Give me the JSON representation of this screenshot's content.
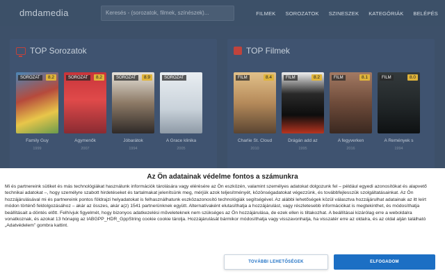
{
  "navbar": {
    "brand": "dmdamedia",
    "search_placeholder": "Keresés - (sorozatok, filmek, színészek)...",
    "items": [
      {
        "label": "FILMEK"
      },
      {
        "label": "SOROZATOK"
      },
      {
        "label": "SZINESZEK"
      },
      {
        "label": "KATEGÓRIÁK"
      },
      {
        "label": "BELÉPÉS"
      }
    ]
  },
  "sections": {
    "series": {
      "title": "TOP Sorozatok",
      "cards": [
        {
          "tag": "SOROZAT",
          "rating": "8.2",
          "title": "Family Guy",
          "year": "1999"
        },
        {
          "tag": "SOROZAT",
          "rating": "8.2",
          "title": "Agymenők",
          "year": "2007"
        },
        {
          "tag": "SOROZAT",
          "rating": "8.9",
          "title": "Jóbarátok",
          "year": "1994"
        },
        {
          "tag": "SOROZAT",
          "rating": "",
          "title": "A Grace klinika",
          "year": "2005"
        }
      ]
    },
    "films": {
      "title": "TOP Filmek",
      "cards": [
        {
          "tag": "FILM",
          "rating": "8.4",
          "title": "Charlie St. Cloud",
          "year": "2010"
        },
        {
          "tag": "FILM",
          "rating": "8.2",
          "title": "Drágán add az",
          "year": "1995"
        },
        {
          "tag": "FILM",
          "rating": "8.1",
          "title": "A fegyverken",
          "year": "2016"
        },
        {
          "tag": "FILM",
          "rating": "8.0",
          "title": "A Remények s",
          "year": "1994"
        }
      ]
    }
  },
  "consent": {
    "title": "Az Ön adatainak védelme fontos a számunkra",
    "body": "Mi és partnereink sütiket és más technológiákat használunk információk tárolására vagy elérésére az Ön eszközén, valamint személyes adatokat dolgozunk fel – például egyedi azonosítókat és alapvető technikai adatokat –, hogy személyre szabott hirdetéseket és tartalmakat jelenítsünk meg, mérjük azok teljesítményét, közönségadatokat végezzünk, és továbbfejlesszük szolgáltatásainkat. Az Ön hozzájárulásával mi és partnereink pontos földrajzi helyadatokat is felhasználhatunk eszközazonosító technológiák segítségével. Az alábbi lehetőségek közül választva hozzájárulhat adatainak az itt leírt módon történő feldolgozásához – akár az összes, akár a(z) 1541 partnerünknek együtt. Alternatívaként elutasíthatja a hozzájárulást, vagy részletesebb információkat is megtekinthet, és módosíthatja beállításait a döntés előtt. Felhívjuk figyelmét, hogy bizonyos adatkezelési műveleteknek nem szükséges az Ön hozzájárulása, de ezek ellen is tiltakozhat. A beállításai kizárólag erre a weboldalra vonatkoznak, és azokat 13 hónapig az IABGPP_HDR_GppString cookie cookie tárolja. Hozzájárulását bármikor módosíthatja vagy visszavonhatja, ha visszatér erre az oldalra, és az oldal alján található „Adatvédelem” gombra kattint.",
    "more_button": "TOVÁBBI LEHETŐSÉGEK",
    "accept_button": "ELFOGADOM"
  },
  "colors": {
    "navbar_bg": "#3c5068",
    "accent_red": "#c0433c",
    "rating_bg": "#e0b43a",
    "primary_blue": "#1c6fc4"
  }
}
